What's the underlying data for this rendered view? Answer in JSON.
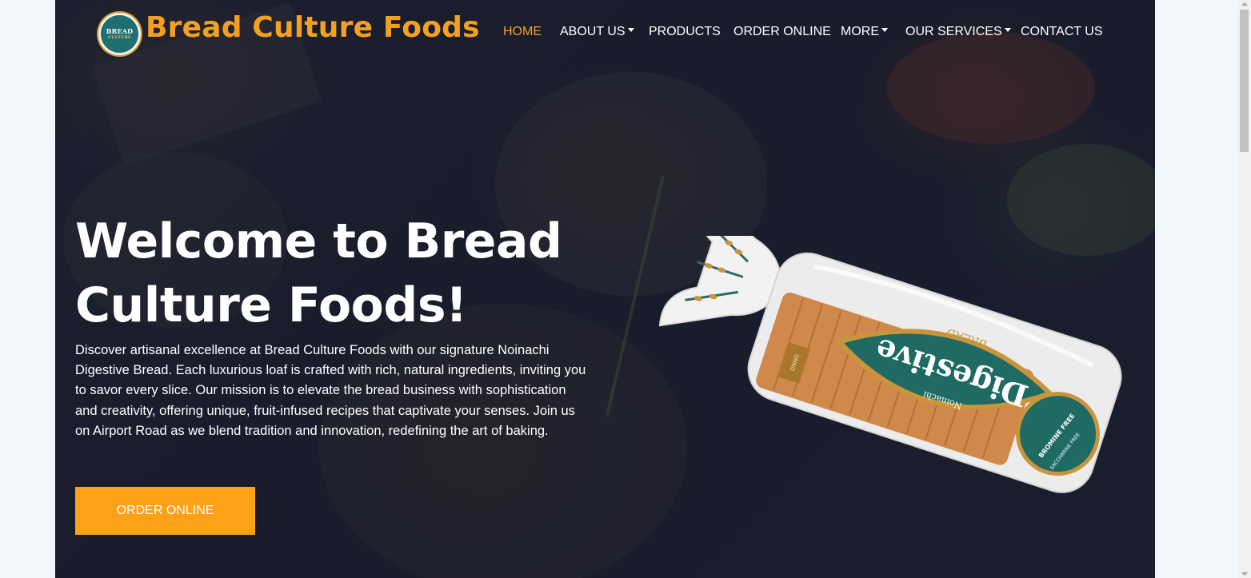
{
  "brand": {
    "name": "Bread Culture Foods",
    "logo_text": "BREAD",
    "logo_subtext": "CULTURE",
    "accent_color": "#f5a11f"
  },
  "nav": {
    "items": [
      {
        "label": "HOME",
        "active": true,
        "dropdown": false
      },
      {
        "label": "ABOUT US",
        "active": false,
        "dropdown": true
      },
      {
        "label": "PRODUCTS",
        "active": false,
        "dropdown": false
      },
      {
        "label": "ORDER ONLINE",
        "active": false,
        "dropdown": false
      },
      {
        "label": "MORE",
        "active": false,
        "dropdown": true
      },
      {
        "label": "OUR SERVICES",
        "active": false,
        "dropdown": true
      },
      {
        "label": "CONTACT US",
        "active": false,
        "dropdown": false
      }
    ]
  },
  "hero": {
    "title_line1": "Welcome to Bread",
    "title_line2": "Culture Foods!",
    "description": "Discover artisanal excellence at Bread Culture Foods with our signature Noinachi Digestive Bread. Each luxurious loaf is crafted with rich, natural ingredients, inviting you to savor every slice. Our mission is to elevate the bread business with sophistication and creativity, offering unique, fruit-infused recipes that captivate your senses. Join us on Airport Road as we blend tradition and innovation, redefining the art of baking.",
    "cta_label": "ORDER ONLINE",
    "cta_color": "#fea116"
  },
  "product_image": {
    "label_main": "Digestive",
    "label_top": "BREAD",
    "label_brand": "Noinachi",
    "label_badge": "BROMINE FREE",
    "label_badge2": "SACCHARINE FREE",
    "label_tag": "DNNO"
  },
  "icons": {
    "dropdown": "caret-down-icon",
    "scroll_up": "scroll-up-arrow-icon",
    "scroll_down": "scroll-down-arrow-icon"
  }
}
